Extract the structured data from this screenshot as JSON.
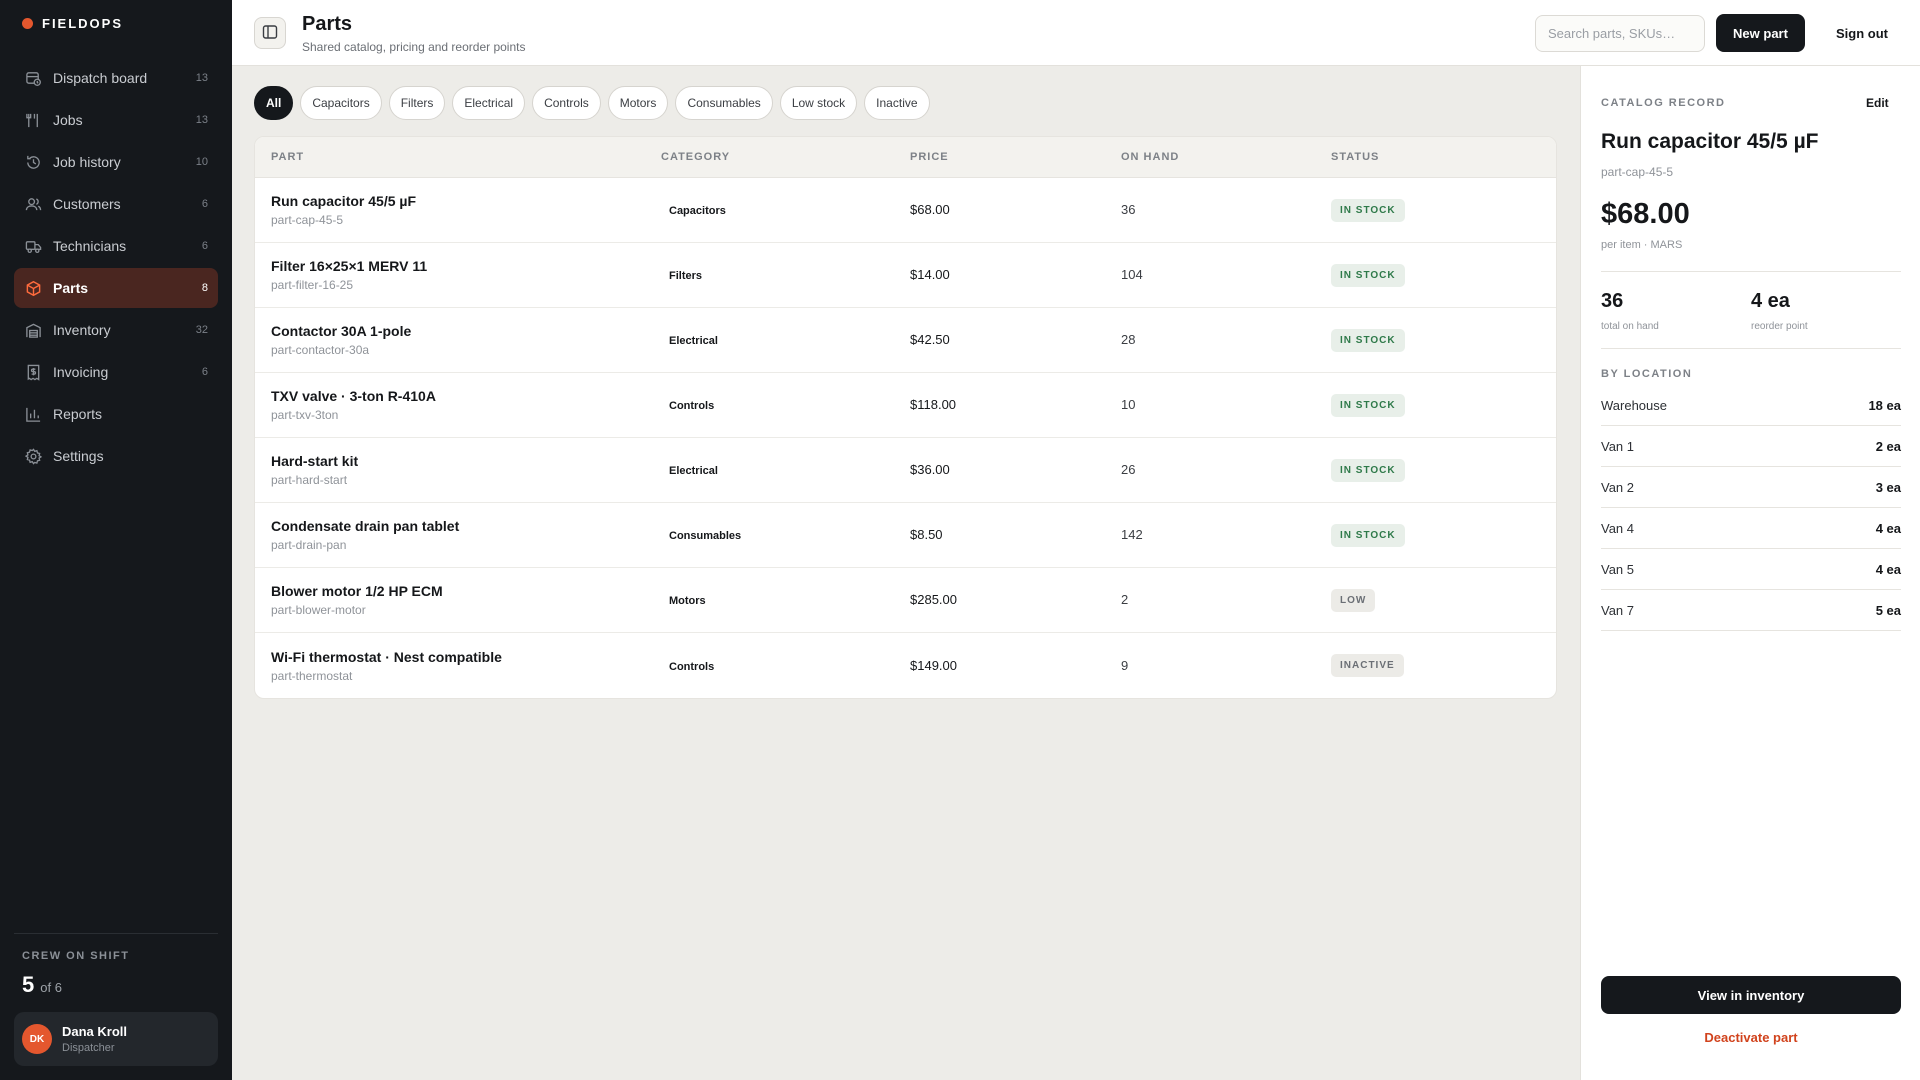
{
  "app": {
    "brand": "FIELDOPS",
    "brand_color": "#e4572e"
  },
  "sidebar": {
    "items": [
      {
        "label": "Dispatch board",
        "count": "13",
        "icon": "calendar-clock-icon",
        "active": false
      },
      {
        "label": "Jobs",
        "count": "13",
        "icon": "wrench-icon",
        "active": false
      },
      {
        "label": "Job history",
        "count": "10",
        "icon": "history-icon",
        "active": false
      },
      {
        "label": "Customers",
        "count": "6",
        "icon": "users-icon",
        "active": false
      },
      {
        "label": "Technicians",
        "count": "6",
        "icon": "truck-icon",
        "active": false
      },
      {
        "label": "Parts",
        "count": "8",
        "icon": "box-icon",
        "active": true
      },
      {
        "label": "Inventory",
        "count": "32",
        "icon": "warehouse-icon",
        "active": false
      },
      {
        "label": "Invoicing",
        "count": "6",
        "icon": "receipt-icon",
        "active": false
      },
      {
        "label": "Reports",
        "count": "",
        "icon": "bar-chart-icon",
        "active": false
      },
      {
        "label": "Settings",
        "count": "",
        "icon": "gear-icon",
        "active": false
      }
    ],
    "crew": {
      "label": "CREW ON SHIFT",
      "count": "5",
      "of": "of 6"
    },
    "user": {
      "initials": "DK",
      "name": "Dana Kroll",
      "role": "Dispatcher"
    }
  },
  "header": {
    "title": "Parts",
    "subtitle": "Shared catalog, pricing and reorder points",
    "search_placeholder": "Search parts, SKUs…",
    "new_label": "New part",
    "signout_label": "Sign out"
  },
  "filters": [
    {
      "label": "All",
      "active": true
    },
    {
      "label": "Capacitors",
      "active": false
    },
    {
      "label": "Filters",
      "active": false
    },
    {
      "label": "Electrical",
      "active": false
    },
    {
      "label": "Controls",
      "active": false
    },
    {
      "label": "Motors",
      "active": false
    },
    {
      "label": "Consumables",
      "active": false
    },
    {
      "label": "Low stock",
      "active": false
    },
    {
      "label": "Inactive",
      "active": false
    }
  ],
  "table": {
    "columns": {
      "part": "PART",
      "category": "CATEGORY",
      "price": "PRICE",
      "on_hand": "ON HAND",
      "status": "STATUS"
    },
    "rows": [
      {
        "name": "Run capacitor 45/5 µF",
        "sku": "part-cap-45-5",
        "category": "Capacitors",
        "price": "$68.00",
        "on_hand": "36",
        "status": "IN STOCK",
        "status_kind": "in"
      },
      {
        "name": "Filter 16×25×1 MERV 11",
        "sku": "part-filter-16-25",
        "category": "Filters",
        "price": "$14.00",
        "on_hand": "104",
        "status": "IN STOCK",
        "status_kind": "in"
      },
      {
        "name": "Contactor 30A 1-pole",
        "sku": "part-contactor-30a",
        "category": "Electrical",
        "price": "$42.50",
        "on_hand": "28",
        "status": "IN STOCK",
        "status_kind": "in"
      },
      {
        "name": "TXV valve · 3-ton R-410A",
        "sku": "part-txv-3ton",
        "category": "Controls",
        "price": "$118.00",
        "on_hand": "10",
        "status": "IN STOCK",
        "status_kind": "in"
      },
      {
        "name": "Hard-start kit",
        "sku": "part-hard-start",
        "category": "Electrical",
        "price": "$36.00",
        "on_hand": "26",
        "status": "IN STOCK",
        "status_kind": "in"
      },
      {
        "name": "Condensate drain pan tablet",
        "sku": "part-drain-pan",
        "category": "Consumables",
        "price": "$8.50",
        "on_hand": "142",
        "status": "IN STOCK",
        "status_kind": "in"
      },
      {
        "name": "Blower motor 1/2 HP ECM",
        "sku": "part-blower-motor",
        "category": "Motors",
        "price": "$285.00",
        "on_hand": "2",
        "status": "LOW",
        "status_kind": "low"
      },
      {
        "name": "Wi-Fi thermostat · Nest compatible",
        "sku": "part-thermostat",
        "category": "Controls",
        "price": "$149.00",
        "on_hand": "9",
        "status": "INACTIVE",
        "status_kind": "inactive"
      }
    ]
  },
  "detail": {
    "label": "CATALOG RECORD",
    "edit_label": "Edit",
    "title": "Run capacitor 45/5 µF",
    "sku": "part-cap-45-5",
    "price": "$68.00",
    "unit": "per item · MARS",
    "total_on_hand": "36",
    "total_on_hand_label": "total on hand",
    "reorder_point": "4 ea",
    "reorder_point_label": "reorder point",
    "by_location_label": "BY LOCATION",
    "locations": [
      {
        "name": "Warehouse",
        "qty": "18 ea"
      },
      {
        "name": "Van 1",
        "qty": "2 ea"
      },
      {
        "name": "Van 2",
        "qty": "3 ea"
      },
      {
        "name": "Van 4",
        "qty": "4 ea"
      },
      {
        "name": "Van 5",
        "qty": "4 ea"
      },
      {
        "name": "Van 7",
        "qty": "5 ea"
      }
    ],
    "view_label": "View in inventory",
    "deactivate_label": "Deactivate part"
  }
}
